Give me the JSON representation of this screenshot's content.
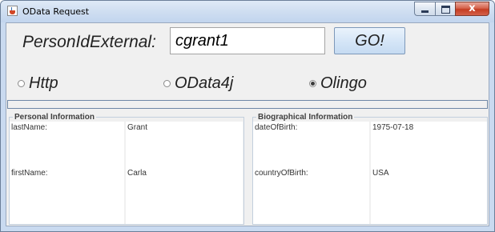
{
  "window": {
    "title": "OData Request",
    "close_glyph": "x"
  },
  "form": {
    "person_label": "PersonIdExternal:",
    "person_value": "cgrant1",
    "go_label": "GO!"
  },
  "radios": [
    {
      "label": "Http",
      "checked": false
    },
    {
      "label": "OData4j",
      "checked": false
    },
    {
      "label": "Olingo",
      "checked": true
    }
  ],
  "personal": {
    "title": "Personal Information",
    "rows": [
      {
        "key": "lastName:",
        "value": "Grant"
      },
      {
        "key": "firstName:",
        "value": "Carla"
      }
    ]
  },
  "biographical": {
    "title": "Biographical Information",
    "rows": [
      {
        "key": "dateOfBirth:",
        "value": "1975-07-18"
      },
      {
        "key": "countryOfBirth:",
        "value": "USA"
      }
    ]
  },
  "icons": {
    "app": "java-cup-icon",
    "minimize": "minimize-icon",
    "maximize": "maximize-icon",
    "close": "close-icon"
  },
  "colors": {
    "titlebar": "#c9daf0",
    "close_button": "#c43c22",
    "content_bg": "#f0f0f0"
  }
}
